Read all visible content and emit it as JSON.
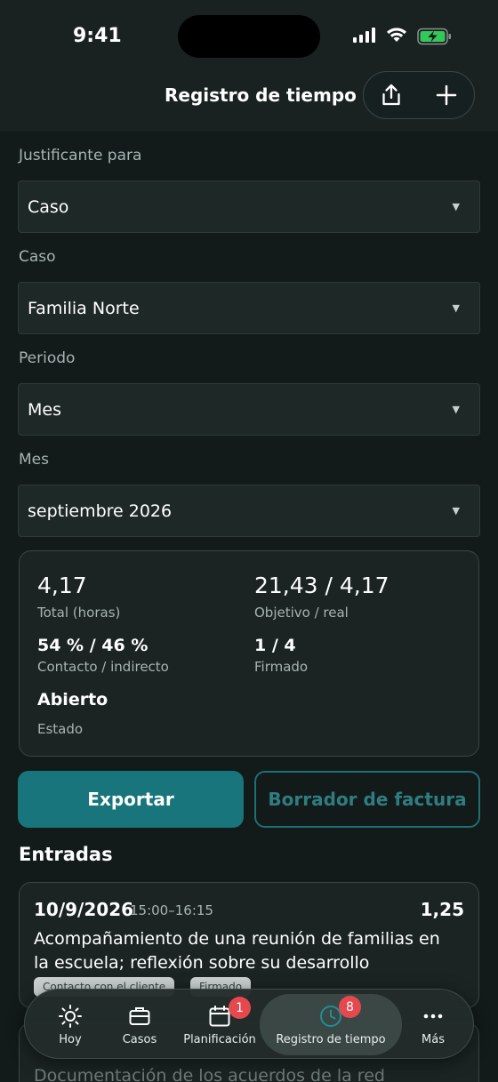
{
  "status_bar": {
    "time": "9:41"
  },
  "header": {
    "title": "Registro de tiempo",
    "actions": [
      "share-icon",
      "plus-icon"
    ]
  },
  "form": {
    "justificante": {
      "label": "Justificante para",
      "value": "Caso"
    },
    "caso": {
      "label": "Caso",
      "value": "Familia Norte"
    },
    "periodo": {
      "label": "Periodo",
      "value": "Mes"
    },
    "mes": {
      "label": "Mes",
      "value": "septiembre 2026"
    }
  },
  "summary": {
    "total": {
      "value": "4,17",
      "caption": "Total (horas)"
    },
    "objetivo": {
      "value": "21,43 / 4,17",
      "caption": "Objetivo / real"
    },
    "contacto": {
      "value": "54 % / 46 %",
      "caption": "Contacto / indirecto"
    },
    "firmado": {
      "value": "1 / 4",
      "caption": "Firmado"
    },
    "estado": {
      "value": "Abierto",
      "caption": "Estado"
    }
  },
  "buttons": {
    "export": "Exportar",
    "invoice_draft": "Borrador de factura"
  },
  "entries_title": "Entradas",
  "entries": [
    {
      "date": "10/9/2026",
      "time": "15:00–16:15",
      "hours": "1,25",
      "description": "Acompañamiento de una reunión de familias en la escuela; reflexión sobre su desarrollo",
      "tags": [
        "Contacto con el cliente",
        "Firmado"
      ]
    },
    {
      "hours": "",
      "description": "Documentación de los acuerdos de la red"
    }
  ],
  "tabs": [
    {
      "label": "Hoy",
      "icon": "sun-icon"
    },
    {
      "label": "Casos",
      "icon": "briefcase-icon"
    },
    {
      "label": "Planificación",
      "icon": "calendar-icon",
      "badge": "1"
    },
    {
      "label": "Registro de tiempo",
      "icon": "clock-icon",
      "badge": "8",
      "active": true
    },
    {
      "label": "Más",
      "icon": "more-icon"
    }
  ],
  "colors": {
    "accent": "#17757b",
    "badge": "#e5484d",
    "background": "#121a1a"
  }
}
